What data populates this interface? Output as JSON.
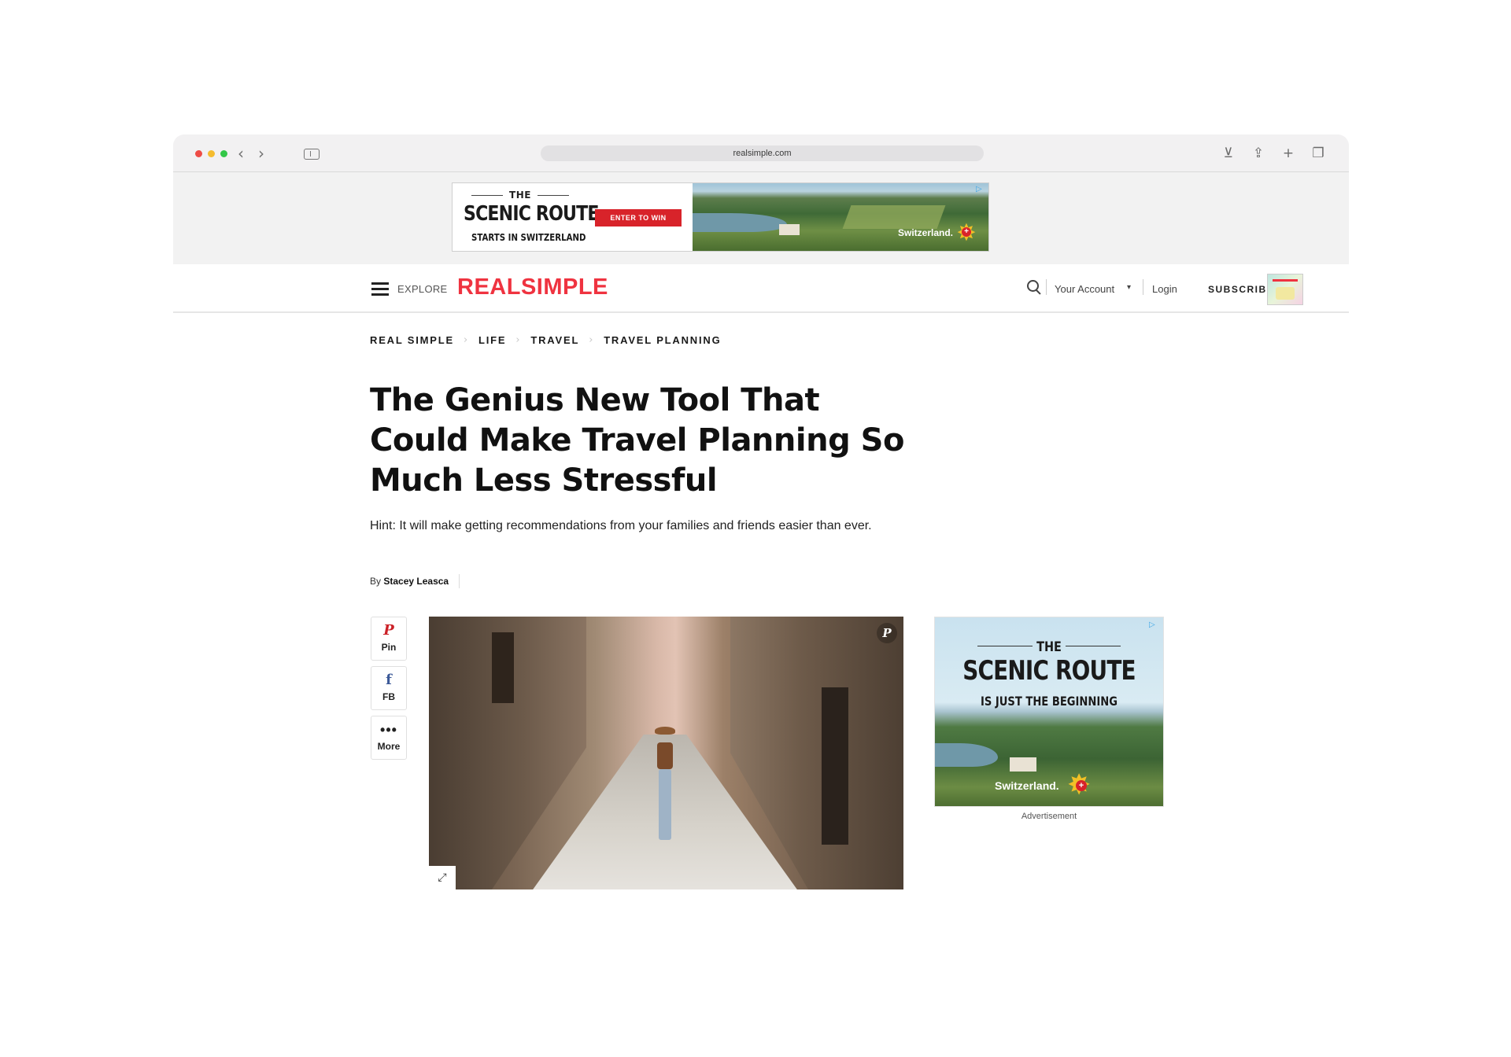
{
  "browser": {
    "url": "realsimple.com",
    "icons": [
      "back-icon",
      "forward-icon",
      "sidebar-icon",
      "download-icon",
      "share-icon",
      "new-tab-icon",
      "tabs-icon"
    ]
  },
  "top_ad": {
    "the": "THE",
    "headline": "SCENIC ROUTE",
    "subline": "STARTS IN SWITZERLAND",
    "cta": "ENTER TO WIN",
    "brand": "Switzerland."
  },
  "header": {
    "explore": "EXPLORE",
    "logo": "REALSIMPLE",
    "account": "Your Account",
    "login": "Login",
    "subscribe": "SUBSCRIBE",
    "logo_color": "#ef3340"
  },
  "breadcrumb": [
    "REAL SIMPLE",
    "LIFE",
    "TRAVEL",
    "TRAVEL PLANNING"
  ],
  "article": {
    "headline": "The Genius New Tool That Could Make Travel Planning So Much Less Stressful",
    "dek": "Hint: It will make getting recommendations from your families and friends easier than ever.",
    "byline_prefix": "By",
    "author": "Stacey Leasca"
  },
  "share": {
    "pin": "Pin",
    "fb": "FB",
    "more": "More"
  },
  "side_ad": {
    "the": "THE",
    "headline": "SCENIC ROUTE",
    "subline": "IS JUST THE BEGINNING",
    "brand": "Switzerland.",
    "caption": "Advertisement"
  }
}
